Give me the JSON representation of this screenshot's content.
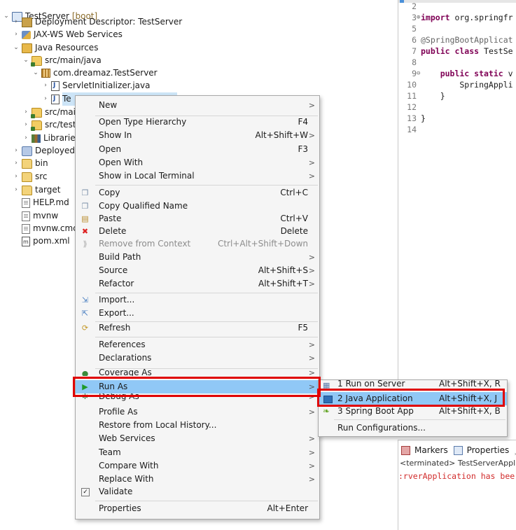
{
  "tree": {
    "project": "TestServer",
    "project_tag": "[boot]",
    "items": [
      "Deployment Descriptor: TestServer",
      "JAX-WS Web Services",
      "Java Resources",
      "src/main/java",
      "com.dreamaz.TestServer",
      "ServletInitializer.java",
      "Te",
      "src/main",
      "src/test/j",
      "Libraries",
      "Deployed R",
      "bin",
      "src",
      "target",
      "HELP.md",
      "mvnw",
      "mvnw.cmd",
      "pom.xml"
    ]
  },
  "editor": {
    "lines": [
      {
        "num": "2",
        "text": ""
      },
      {
        "num": "3",
        "kw": "import",
        "text": " org.springfr"
      },
      {
        "num": "5",
        "text": ""
      },
      {
        "num": "6",
        "ann": "@SpringBootApplicat"
      },
      {
        "num": "7",
        "kw": "public class",
        "text": " TestSe"
      },
      {
        "num": "8",
        "text": ""
      },
      {
        "num": "9",
        "kw": "    public static",
        "text": " v"
      },
      {
        "num": "10",
        "text": "        SpringAppli"
      },
      {
        "num": "11",
        "text": "    }"
      },
      {
        "num": "12",
        "text": ""
      },
      {
        "num": "13",
        "text": "}"
      },
      {
        "num": "14",
        "text": ""
      }
    ]
  },
  "console": {
    "tab_markers": "Markers",
    "tab_properties": "Properties",
    "tab_partial": "S",
    "terminated": "<terminated> TestServerApplic",
    "error_text": ":rverApplication has bee"
  },
  "menu": {
    "items": [
      {
        "label": "New",
        "arrow": ">"
      },
      {
        "label": "Open Type Hierarchy",
        "shortcut": "F4"
      },
      {
        "label": "Show In",
        "shortcut": "Alt+Shift+W",
        "arrow": ">"
      },
      {
        "label": "Open",
        "shortcut": "F3"
      },
      {
        "label": "Open With",
        "arrow": ">"
      },
      {
        "label": "Show in Local Terminal",
        "arrow": ">"
      },
      {
        "label": "Copy",
        "shortcut": "Ctrl+C"
      },
      {
        "label": "Copy Qualified Name"
      },
      {
        "label": "Paste",
        "shortcut": "Ctrl+V"
      },
      {
        "label": "Delete",
        "shortcut": "Delete"
      },
      {
        "label": "Remove from Context",
        "shortcut": "Ctrl+Alt+Shift+Down",
        "disabled": true
      },
      {
        "label": "Build Path",
        "arrow": ">"
      },
      {
        "label": "Source",
        "shortcut": "Alt+Shift+S",
        "arrow": ">"
      },
      {
        "label": "Refactor",
        "shortcut": "Alt+Shift+T",
        "arrow": ">"
      },
      {
        "label": "Import..."
      },
      {
        "label": "Export..."
      },
      {
        "label": "Refresh",
        "shortcut": "F5"
      },
      {
        "label": "References",
        "arrow": ">"
      },
      {
        "label": "Declarations",
        "arrow": ">"
      },
      {
        "label": "Coverage As",
        "arrow": ">"
      },
      {
        "label": "Run As",
        "arrow": ">"
      },
      {
        "label": "Debug As",
        "arrow": ">"
      },
      {
        "label": "Profile As",
        "arrow": ">"
      },
      {
        "label": "Restore from Local History..."
      },
      {
        "label": "Web Services",
        "arrow": ">"
      },
      {
        "label": "Team",
        "arrow": ">"
      },
      {
        "label": "Compare With",
        "arrow": ">"
      },
      {
        "label": "Replace With",
        "arrow": ">"
      },
      {
        "label": "Validate"
      },
      {
        "label": "Properties",
        "shortcut": "Alt+Enter"
      }
    ]
  },
  "submenu": {
    "items": [
      {
        "label": "1 Run on Server",
        "shortcut": "Alt+Shift+X, R"
      },
      {
        "label": "2 Java Application",
        "shortcut": "Alt+Shift+X, J"
      },
      {
        "label": "3 Spring Boot App",
        "shortcut": "Alt+Shift+X, B"
      },
      {
        "label": "Run Configurations..."
      }
    ]
  },
  "colors": {
    "highlight": "#90c8f6",
    "annotation_box": "#e00000",
    "keyword": "#7f0055",
    "error": "#d12b2b"
  }
}
